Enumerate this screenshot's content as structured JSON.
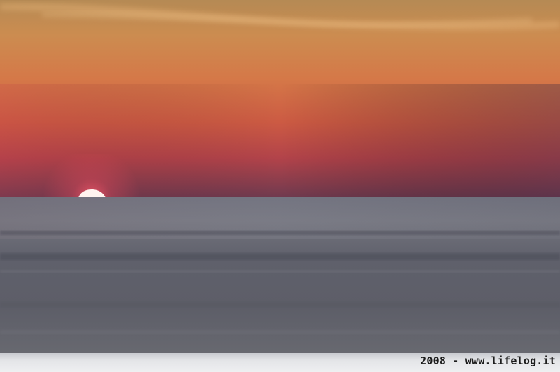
{
  "photo": {
    "caption": "2008 - www.lifelog.it"
  },
  "colors": {
    "sky_top": "#b8894e",
    "sky_upper": "#cf8b4f",
    "sky_mid": "#d56d44",
    "sky_low": "#bd4641",
    "sky_horizon": "#70374d",
    "sun": "#fff2ee",
    "sun_glow": "#ff6a78",
    "sea_top": "#686874",
    "sea_mid": "#5c5d68",
    "sea_bottom": "#67686f"
  }
}
